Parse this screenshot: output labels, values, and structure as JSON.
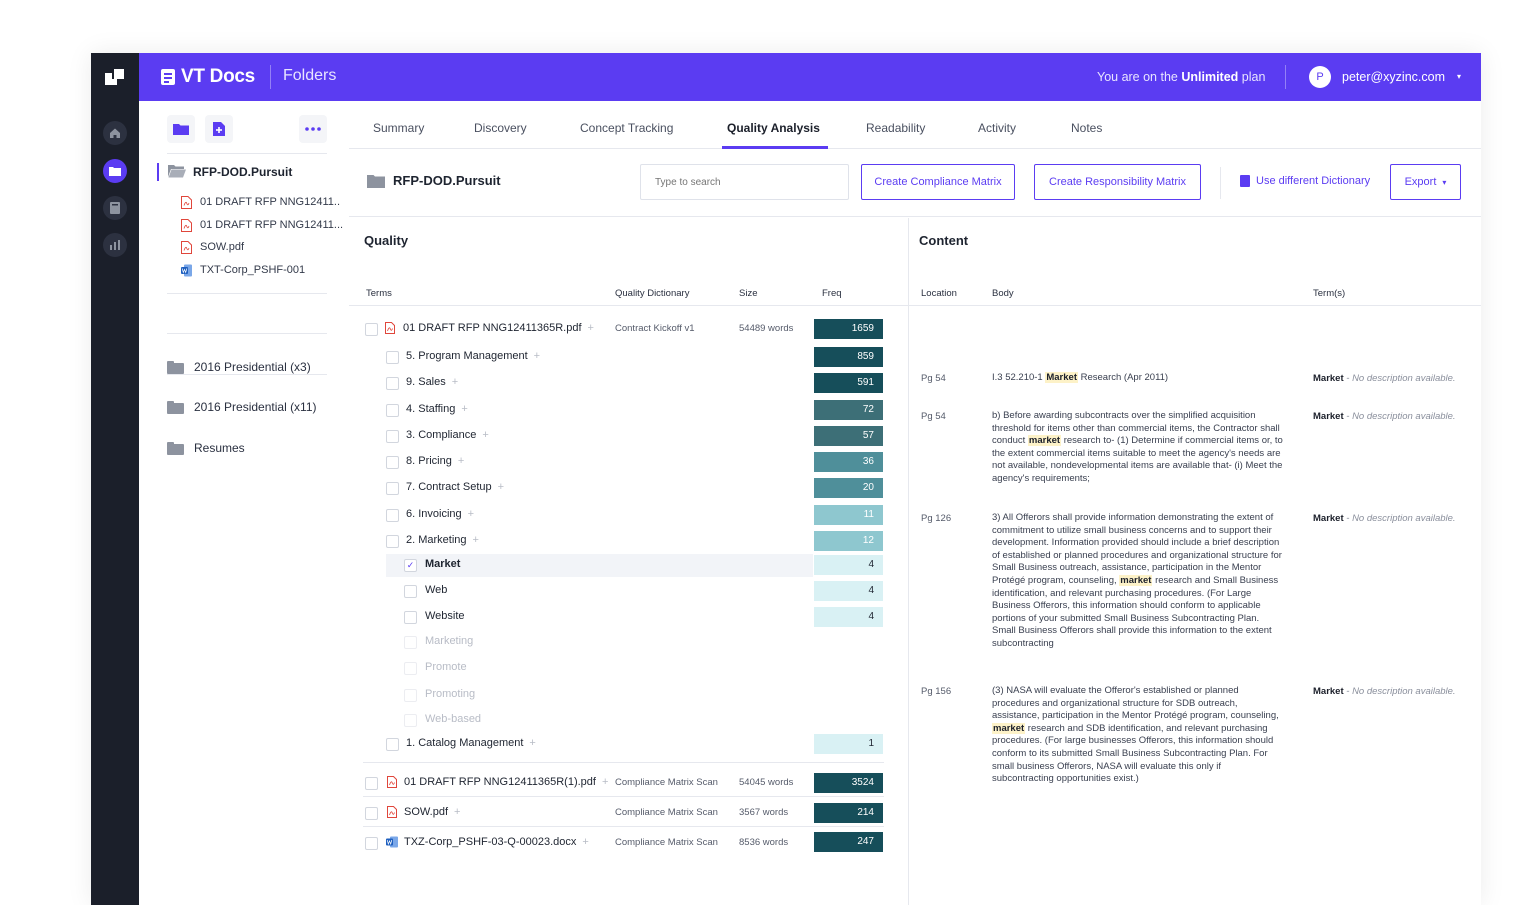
{
  "app": {
    "brand": "VT Docs",
    "section": "Folders"
  },
  "topbar": {
    "plan_prefix": "You are on the ",
    "plan_name": "Unlimited",
    "plan_suffix": " plan",
    "avatar_initial": "P",
    "user_email": "peter@xyzinc.com",
    "caret": "▾"
  },
  "sidebar": {
    "root": "RFP-DOD.Pursuit",
    "files": [
      "01 DRAFT RFP NNG12411..",
      "01 DRAFT RFP NNG12411...",
      "SOW.pdf",
      "TXT-Corp_PSHF-001"
    ],
    "folders": [
      "2016 Presidential (x3)",
      "2016 Presidential (x11)",
      "Resumes"
    ]
  },
  "tabs": [
    "Summary",
    "Discovery",
    "Concept Tracking",
    "Quality Analysis",
    "Readability",
    "Activity",
    "Notes"
  ],
  "active_tab": "Quality Analysis",
  "toolbar": {
    "title": "RFP-DOD.Pursuit",
    "search_placeholder": "Type to search",
    "compliance_btn": "Create Compliance Matrix",
    "responsibility_btn": "Create Responsibility Matrix",
    "dictionary_btn": "Use different Dictionary",
    "export_btn": "Export",
    "export_caret": "▾"
  },
  "quality": {
    "heading": "Quality",
    "columns": {
      "terms": "Terms",
      "dictionary": "Quality Dictionary",
      "size": "Size",
      "freq": "Freq"
    },
    "doc1": {
      "name": "01 DRAFT RFP NNG12411365R.pdf",
      "dictionary": "Contract Kickoff v1",
      "size": "54489 words",
      "freq": "1659"
    },
    "categories": [
      {
        "label": "5. Program Management",
        "freq": "859"
      },
      {
        "label": "9. Sales",
        "freq": "591"
      },
      {
        "label": "4. Staffing",
        "freq": "72"
      },
      {
        "label": "3. Compliance",
        "freq": "57"
      },
      {
        "label": "8. Pricing",
        "freq": "36"
      },
      {
        "label": "7. Contract Setup",
        "freq": "20"
      },
      {
        "label": "6. Invoicing",
        "freq": "11"
      },
      {
        "label": "2. Marketing",
        "freq": "12"
      }
    ],
    "subterms": [
      {
        "label": "Market",
        "freq": "4"
      },
      {
        "label": "Web",
        "freq": "4"
      },
      {
        "label": "Website",
        "freq": "4"
      }
    ],
    "faint_terms": [
      "Marketing",
      "Promote",
      "Promoting",
      "Web-based"
    ],
    "catalog": {
      "label": "1. Catalog Management",
      "freq": "1"
    },
    "docs": [
      {
        "name": "01 DRAFT RFP NNG12411365R(1).pdf",
        "dictionary": "Compliance Matrix Scan",
        "size": "54045 words",
        "freq": "3524"
      },
      {
        "name": "SOW.pdf",
        "dictionary": "Compliance Matrix Scan",
        "size": "3567 words",
        "freq": "214"
      },
      {
        "name": "TXZ-Corp_PSHF-03-Q-00023.docx",
        "dictionary": "Compliance Matrix Scan",
        "size": "8536 words",
        "freq": "247"
      }
    ],
    "plus": "+",
    "check": "✓"
  },
  "content": {
    "heading": "Content",
    "columns": {
      "location": "Location",
      "body": "Body",
      "terms": "Term(s)"
    },
    "term_name": "Market",
    "term_desc": " - No description available.",
    "rows": [
      {
        "loc": "Pg 54",
        "pre": "I.3 52.210-1 ",
        "hl": "Market",
        "post": " Research (Apr 2011)"
      },
      {
        "loc": "Pg 54",
        "pre": "b) Before awarding subcontracts over the simplified acquisition threshold for items other than commercial items, the Contractor shall conduct ",
        "hl": "market",
        "post": " research to- (1) Determine if commercial items or, to the extent commercial items suitable to meet the agency's needs are not available, nondevelopmental items are available that- (i) Meet the agency's requirements;"
      },
      {
        "loc": "Pg 126",
        "pre": "3) All Offerors shall provide information demonstrating the extent of commitment to utilize small business concerns and to support their development. Information provided should include a brief description of established or planned procedures and organizational structure for Small Business outreach, assistance, participation in the Mentor Protégé program, counseling, ",
        "hl": "market",
        "post": " research and Small Business identification, and relevant purchasing procedures. (For Large Business Offerors, this information should conform to applicable portions of your submitted Small Business Subcontracting Plan. Small Business Offerors shall provide this information to the extent subcontracting"
      },
      {
        "loc": "Pg 156",
        "pre": "(3) NASA will evaluate the Offeror's established or planned procedures and organizational structure for SDB outreach, assistance, participation in the Mentor Protégé program, counseling, ",
        "hl": "market",
        "post": " research and SDB identification, and relevant purchasing procedures. (For large businesses Offerors, this information should conform to its submitted Small Business Subcontracting Plan. For small business Offerors, NASA will evaluate this only if subcontracting opportunities exist.)"
      }
    ]
  },
  "colors": {
    "accent": "#5b3cf2",
    "rail": "#1b1f2a",
    "freq_dark": "#164e5a",
    "freq_mid": "#3d7f86",
    "freq_light": "#a9d9df",
    "freq_pale": "#d9f1f4"
  }
}
